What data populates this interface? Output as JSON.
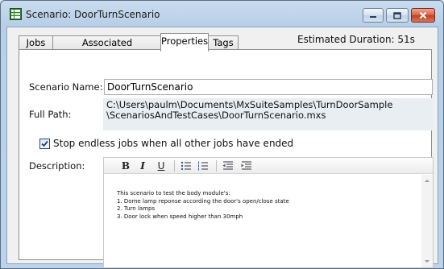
{
  "window": {
    "title": "Scenario: DoorTurnScenario",
    "icon": "scenario-grid-icon",
    "controls": {
      "minimize_icon": "minimize-icon",
      "maximize_icon": "maximize-icon",
      "close_icon": "close-icon"
    }
  },
  "tabs": [
    {
      "label": "Jobs"
    },
    {
      "label": "Associated Requirements"
    },
    {
      "label": "Properties",
      "active": true
    },
    {
      "label": "Tags"
    }
  ],
  "duration": "Estimated Duration: 51s",
  "properties": {
    "scenario_name_label": "Scenario Name:",
    "scenario_name_value": "DoorTurnScenario",
    "full_path_label": "Full Path:",
    "full_path_line1": "C:\\Users\\paulm\\Documents\\MxSuiteSamples\\TurnDoorSample",
    "full_path_line2": "\\ScenariosAndTestCases\\DoorTurnScenario.mxs",
    "stop_jobs_label": "Stop endless jobs when all other jobs have ended",
    "stop_jobs_checked": true,
    "description_label": "Description:",
    "description_lines": [
      "This scenario to test the body module's:",
      "1. Dome lamp reponse according the door's open/close state",
      "2. Turn lamps",
      "3. Door lock when speed higher than 30mph"
    ]
  },
  "toolbar": {
    "bold": "B",
    "italic": "I",
    "underline": "U",
    "bullets_icon": "bulleted-list-icon",
    "numbering_icon": "numbered-list-icon",
    "outdent_icon": "outdent-icon",
    "indent_icon": "indent-icon"
  }
}
